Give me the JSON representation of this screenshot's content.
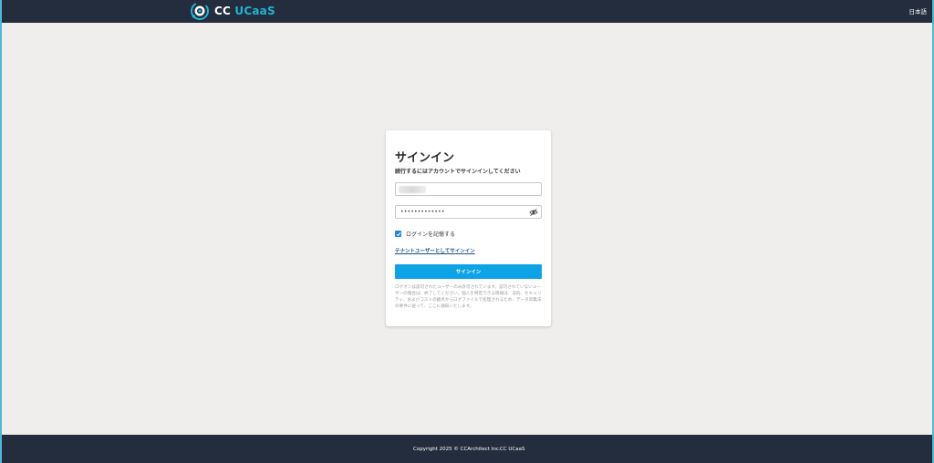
{
  "header": {
    "logo_cc": "CC",
    "logo_ucaas": "UCaaS",
    "language": "日本語"
  },
  "login": {
    "title": "サインイン",
    "subtitle": "続行するにはアカウントでサインインしてください",
    "password_mask": "•••••••••••••",
    "remember_label": "ログインを記憶する",
    "remember_checked": true,
    "tenant_link": "テナントユーザーとしてサインイン",
    "signin_button": "サインイン",
    "notice": "ログオンは認可されたユーザーのみ許可されています。認可されていないユーザーの場合は、終了してください。個人を特定できる情報は、法的、セキュリティ、およびコストの観点からログファイルで処理されるため、データ収集法の要件に従って、ここに通知いたします。"
  },
  "footer": {
    "copyright": "Copyright 2025 © CCArchitect Inc.",
    "brand": "CC UCaaS"
  },
  "colors": {
    "topbar": "#232d3d",
    "accent": "#0da3e6",
    "logo_accent": "#22b3d4",
    "background": "#efeeec"
  }
}
